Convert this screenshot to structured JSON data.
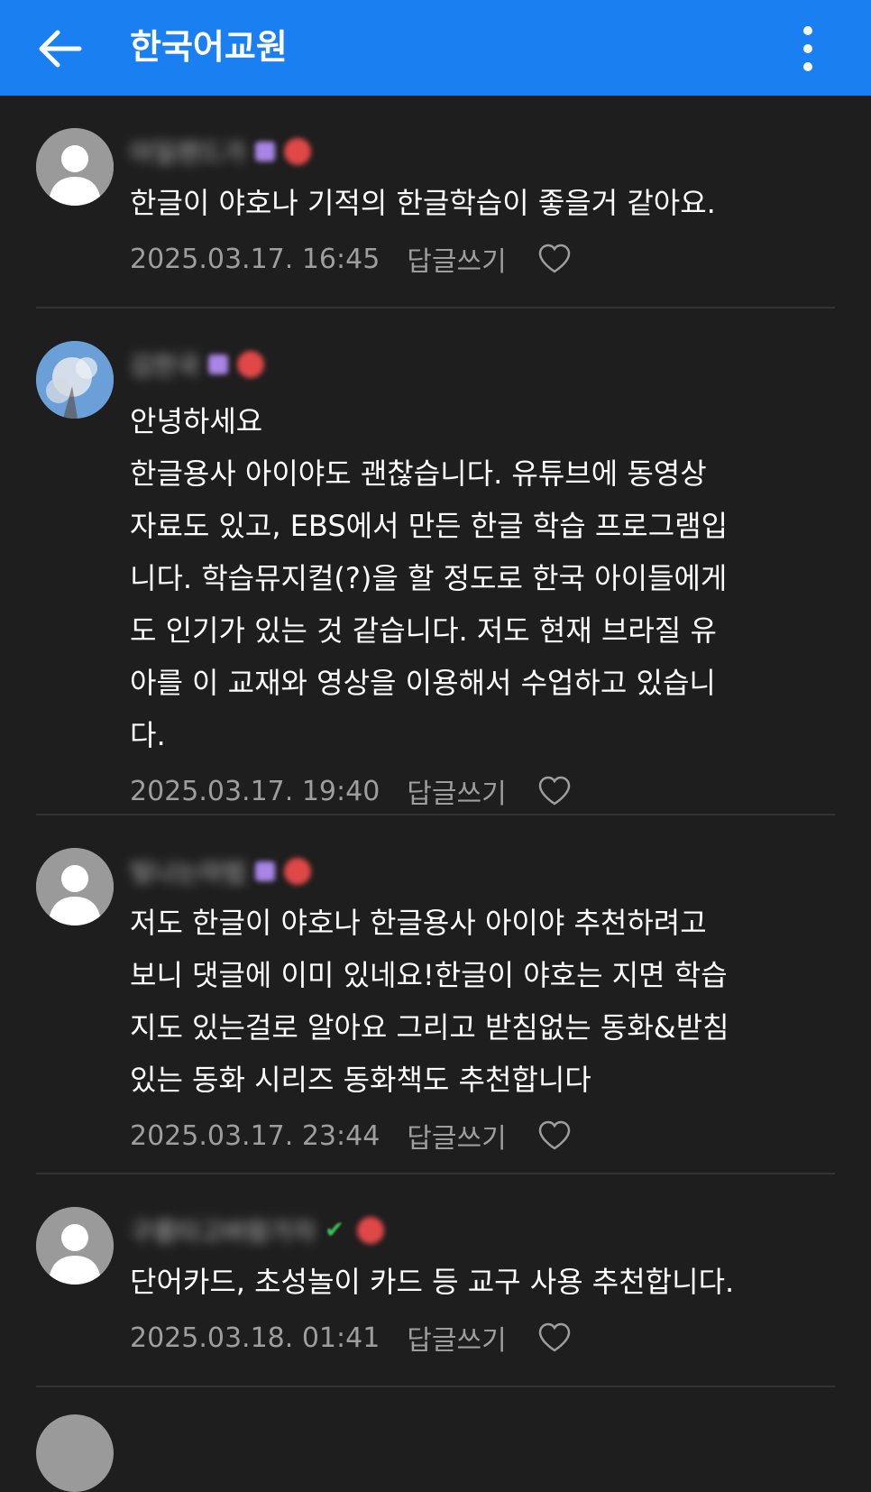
{
  "header": {
    "title": "한국어교원",
    "back_icon": "arrow-left-icon",
    "more_icon": "more-vertical-icon",
    "bg_color": "#1a7ff0"
  },
  "comments": [
    {
      "nickname": "아일랜드가",
      "avatar": "default-avatar-icon",
      "badge": "purple",
      "text": "한글이 야호나 기적의 한글학습이 좋을거 같아요.",
      "date": "2025.03.17. 16:45",
      "reply_label": "답글쓰기",
      "like_icon": "heart-outline-icon"
    },
    {
      "nickname": "김한국",
      "avatar": "photo",
      "badge": "purple",
      "text": "안녕하세요\n한글용사 아이야도 괜찮습니다. 유튜브에 동영상\n자료도 있고, EBS에서 만든 한글 학습 프로그램입\n니다. 학습뮤지컬(?)을 할 정도로 한국 아이들에게\n도 인기가 있는 것 같습니다. 저도 현재 브라질 유\n아를 이 교재와 영상을 이용해서 수업하고 있습니\n다.",
      "date": "2025.03.17. 19:40",
      "reply_label": "답글쓰기",
      "like_icon": "heart-outline-icon"
    },
    {
      "nickname": "빛나는마법",
      "avatar": "default-avatar-icon",
      "badge": "purple",
      "text": "저도 한글이 야호나 한글용사 아이야 추천하려고\n보니 댓글에 이미 있네요!한글이 야호는 지면 학습\n지도 있는걸로 알아요 그리고 받침없는 동화&받침\n있는 동화 시리즈 동화책도 추천합니다",
      "date": "2025.03.17. 23:44",
      "reply_label": "답글쓰기",
      "like_icon": "heart-outline-icon"
    },
    {
      "nickname": "구름타고바람가자",
      "avatar": "default-avatar-icon",
      "badge": "check",
      "text": "단어카드, 초성놀이 카드 등 교구 사용 추천합니다.",
      "date": "2025.03.18. 01:41",
      "reply_label": "답글쓰기",
      "like_icon": "heart-outline-icon"
    }
  ]
}
